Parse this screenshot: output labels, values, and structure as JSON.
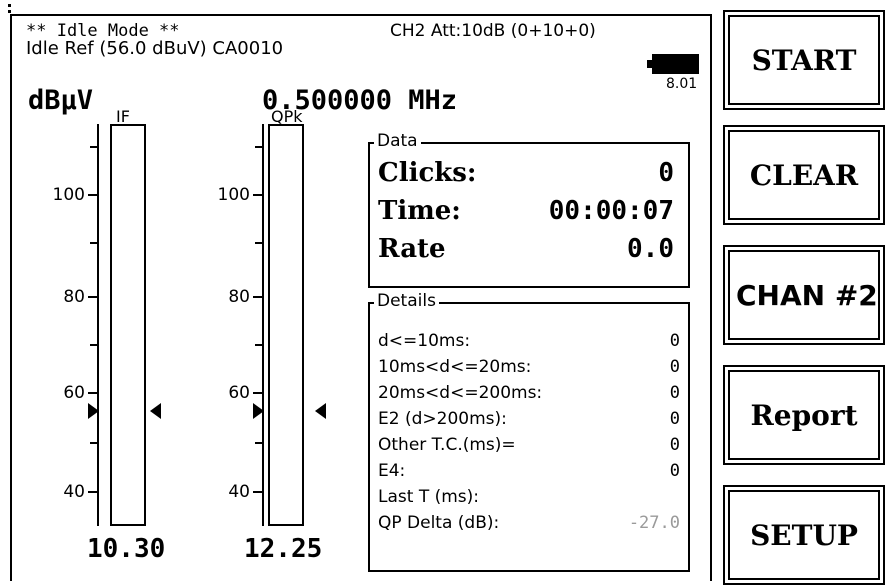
{
  "header": {
    "mode": "** Idle Mode **",
    "ref": "Idle Ref (56.0 dBuV) CA0010",
    "attenuation": "CH2 Att:10dB (0+10+0)",
    "battery_icon": "battery-icon",
    "battery_value": "8.01"
  },
  "units": "dBµV",
  "frequency": "0.500000 MHz",
  "meters": [
    {
      "title": "IF",
      "reading": "10.30",
      "ticks": [
        "100",
        "80",
        "60",
        "40"
      ]
    },
    {
      "title": "QPk",
      "reading": "12.25",
      "ticks": [
        "100",
        "80",
        "60",
        "40"
      ]
    }
  ],
  "data_box": {
    "legend": "Data",
    "rows": [
      {
        "label": "Clicks:",
        "value": "0"
      },
      {
        "label": "Time:",
        "value": "00:00:07"
      },
      {
        "label": "Rate",
        "value": "0.0"
      }
    ]
  },
  "details_box": {
    "legend": "Details",
    "rows": [
      {
        "label": "d<=10ms:",
        "value": "0"
      },
      {
        "label": "10ms<d<=20ms:",
        "value": "0"
      },
      {
        "label": "20ms<d<=200ms:",
        "value": "0"
      },
      {
        "label": "E2 (d>200ms):",
        "value": "0"
      },
      {
        "label": "Other T.C.(ms)=",
        "value": "0"
      },
      {
        "label": "E4:",
        "value": "0"
      },
      {
        "label": "Last T (ms):",
        "value": ""
      },
      {
        "label": "QP Delta (dB):",
        "value": "-27.0"
      }
    ]
  },
  "buttons": {
    "start": "START",
    "clear": "CLEAR",
    "chan": "CHAN #2",
    "report": "Report",
    "setup": "SETUP"
  },
  "colors": {
    "qp_delta_value": "#9a9a9a"
  }
}
